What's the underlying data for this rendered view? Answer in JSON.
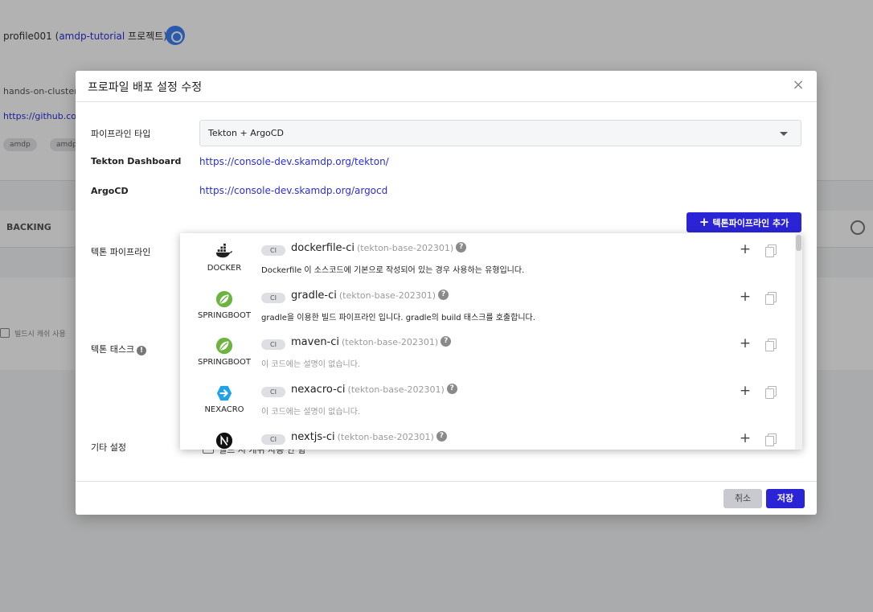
{
  "background": {
    "title_prefix": "profile001 (",
    "title_link": "amdp-tutorial",
    "title_suffix": " 프로젝트)",
    "line1": "hands-on-cluster",
    "line2": "https://github.com",
    "chips": [
      "amdp",
      "amdp"
    ],
    "tab": "BACKING",
    "checkbox_label": "빌드시 캐쉬 사용"
  },
  "modal": {
    "title": "프로파일 배포 설정 수정",
    "fields": {
      "pipeline_type_label": "파이프라인 타입",
      "pipeline_type_value": "Tekton + ArgoCD",
      "tekton_dashboard_label": "Tekton Dashboard",
      "tekton_dashboard_url": "https://console-dev.skamdp.org/tekton/",
      "argocd_label": "ArgoCD",
      "argocd_url": "https://console-dev.skamdp.org/argocd",
      "tekton_pipeline_label": "텍톤 파이프라인",
      "add_pipeline_button": "텍톤파이프라인 추가",
      "tekton_task_label": "텍톤 태스크",
      "etc_label": "기타 설정",
      "etc_checkbox_label": "빌드 시 캐쉬 사용 안 함"
    },
    "footer": {
      "cancel": "취소",
      "save": "저장"
    }
  },
  "pipeline_list": [
    {
      "logo": "DOCKER",
      "icon": "docker-icon",
      "badge": "CI",
      "name": "dockerfile-ci",
      "version": "(tekton-base-202301)",
      "description": "Dockerfile 이 소스코드에 기본으로 작성되어 있는 경우 사용하는 유형입니다.",
      "muted": false
    },
    {
      "logo": "SPRINGBOOT",
      "icon": "springboot-icon",
      "badge": "CI",
      "name": "gradle-ci",
      "version": "(tekton-base-202301)",
      "description": "gradle을 이용한 빌드 파이프라인 입니다. gradle의 build 태스크를 호출합니다.",
      "muted": false
    },
    {
      "logo": "SPRINGBOOT",
      "icon": "springboot-icon",
      "badge": "CI",
      "name": "maven-ci",
      "version": "(tekton-base-202301)",
      "description": "이 코드에는 설명이 없습니다.",
      "muted": true
    },
    {
      "logo": "NEXACRO",
      "icon": "nexacro-icon",
      "badge": "CI",
      "name": "nexacro-ci",
      "version": "(tekton-base-202301)",
      "description": "이 코드에는 설명이 없습니다.",
      "muted": true
    },
    {
      "logo": "",
      "icon": "nextjs-icon",
      "badge": "CI",
      "name": "nextjs-ci",
      "version": "(tekton-base-202301)",
      "description": "",
      "muted": true
    }
  ],
  "colors": {
    "primary": "#2a24d6",
    "link": "#2b2fd9",
    "overlay": "rgba(0,0,0,0.3)"
  }
}
